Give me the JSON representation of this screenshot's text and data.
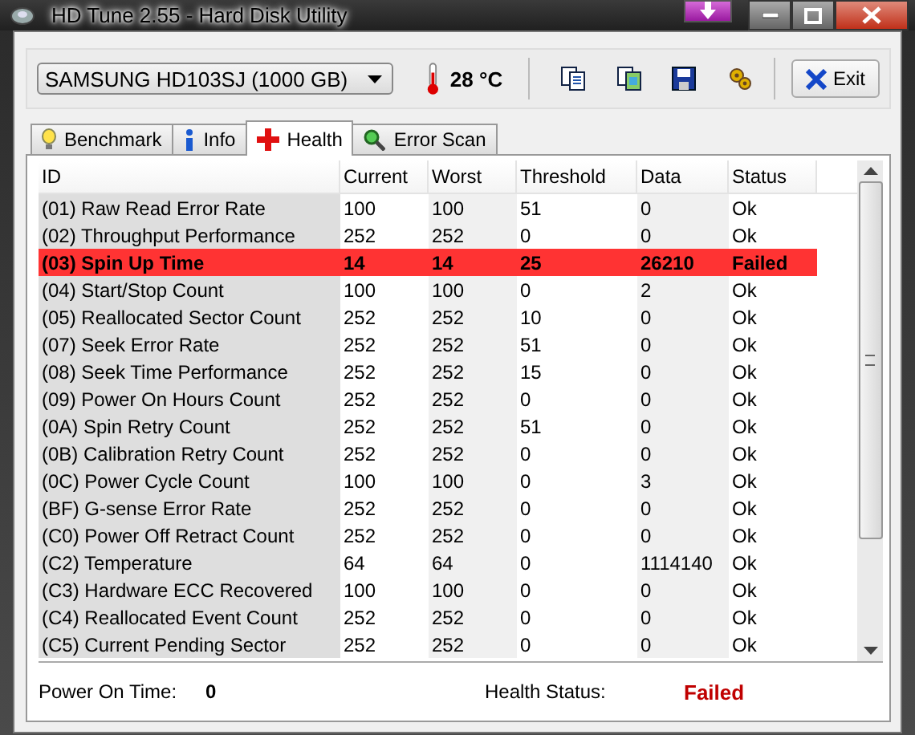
{
  "window": {
    "title": "HD Tune 2.55 - Hard Disk Utility"
  },
  "drive": {
    "value": "SAMSUNG HD103SJ (1000 GB)"
  },
  "temperature": "28 °C",
  "exit_button": "Exit",
  "tabs": [
    {
      "label": "Benchmark",
      "selected": false,
      "kind": "benchmark"
    },
    {
      "label": "Info",
      "selected": false,
      "kind": "info"
    },
    {
      "label": "Health",
      "selected": true,
      "kind": "health"
    },
    {
      "label": "Error Scan",
      "selected": false,
      "kind": "scan"
    }
  ],
  "table": {
    "columns": [
      "ID",
      "Current",
      "Worst",
      "Threshold",
      "Data",
      "Status"
    ],
    "rows": [
      {
        "cells": [
          "(01) Raw Read Error Rate",
          "100",
          "100",
          "51",
          "0",
          "Ok"
        ],
        "failed": false
      },
      {
        "cells": [
          "(02) Throughput Performance",
          "252",
          "252",
          "0",
          "0",
          "Ok"
        ],
        "failed": false
      },
      {
        "cells": [
          "(03) Spin Up Time",
          "14",
          "14",
          "25",
          "26210",
          "Failed"
        ],
        "failed": true
      },
      {
        "cells": [
          "(04) Start/Stop Count",
          "100",
          "100",
          "0",
          "2",
          "Ok"
        ],
        "failed": false
      },
      {
        "cells": [
          "(05) Reallocated Sector Count",
          "252",
          "252",
          "10",
          "0",
          "Ok"
        ],
        "failed": false
      },
      {
        "cells": [
          "(07) Seek Error Rate",
          "252",
          "252",
          "51",
          "0",
          "Ok"
        ],
        "failed": false
      },
      {
        "cells": [
          "(08) Seek Time Performance",
          "252",
          "252",
          "15",
          "0",
          "Ok"
        ],
        "failed": false
      },
      {
        "cells": [
          "(09) Power On Hours Count",
          "252",
          "252",
          "0",
          "0",
          "Ok"
        ],
        "failed": false
      },
      {
        "cells": [
          "(0A) Spin Retry Count",
          "252",
          "252",
          "51",
          "0",
          "Ok"
        ],
        "failed": false
      },
      {
        "cells": [
          "(0B) Calibration Retry Count",
          "252",
          "252",
          "0",
          "0",
          "Ok"
        ],
        "failed": false
      },
      {
        "cells": [
          "(0C) Power Cycle Count",
          "100",
          "100",
          "0",
          "3",
          "Ok"
        ],
        "failed": false
      },
      {
        "cells": [
          "(BF) G-sense Error Rate",
          "252",
          "252",
          "0",
          "0",
          "Ok"
        ],
        "failed": false
      },
      {
        "cells": [
          "(C0) Power Off Retract Count",
          "252",
          "252",
          "0",
          "0",
          "Ok"
        ],
        "failed": false
      },
      {
        "cells": [
          "(C2) Temperature",
          "64",
          "64",
          "0",
          "1114140",
          "Ok"
        ],
        "failed": false
      },
      {
        "cells": [
          "(C3) Hardware ECC Recovered",
          "100",
          "100",
          "0",
          "0",
          "Ok"
        ],
        "failed": false
      },
      {
        "cells": [
          "(C4) Reallocated Event Count",
          "252",
          "252",
          "0",
          "0",
          "Ok"
        ],
        "failed": false
      },
      {
        "cells": [
          "(C5) Current Pending Sector",
          "252",
          "252",
          "0",
          "0",
          "Ok"
        ],
        "failed": false
      }
    ]
  },
  "power_on_time": {
    "label": "Power On Time:",
    "value": "0"
  },
  "health_status": {
    "label": "Health Status:",
    "value": "Failed",
    "failed": true
  }
}
